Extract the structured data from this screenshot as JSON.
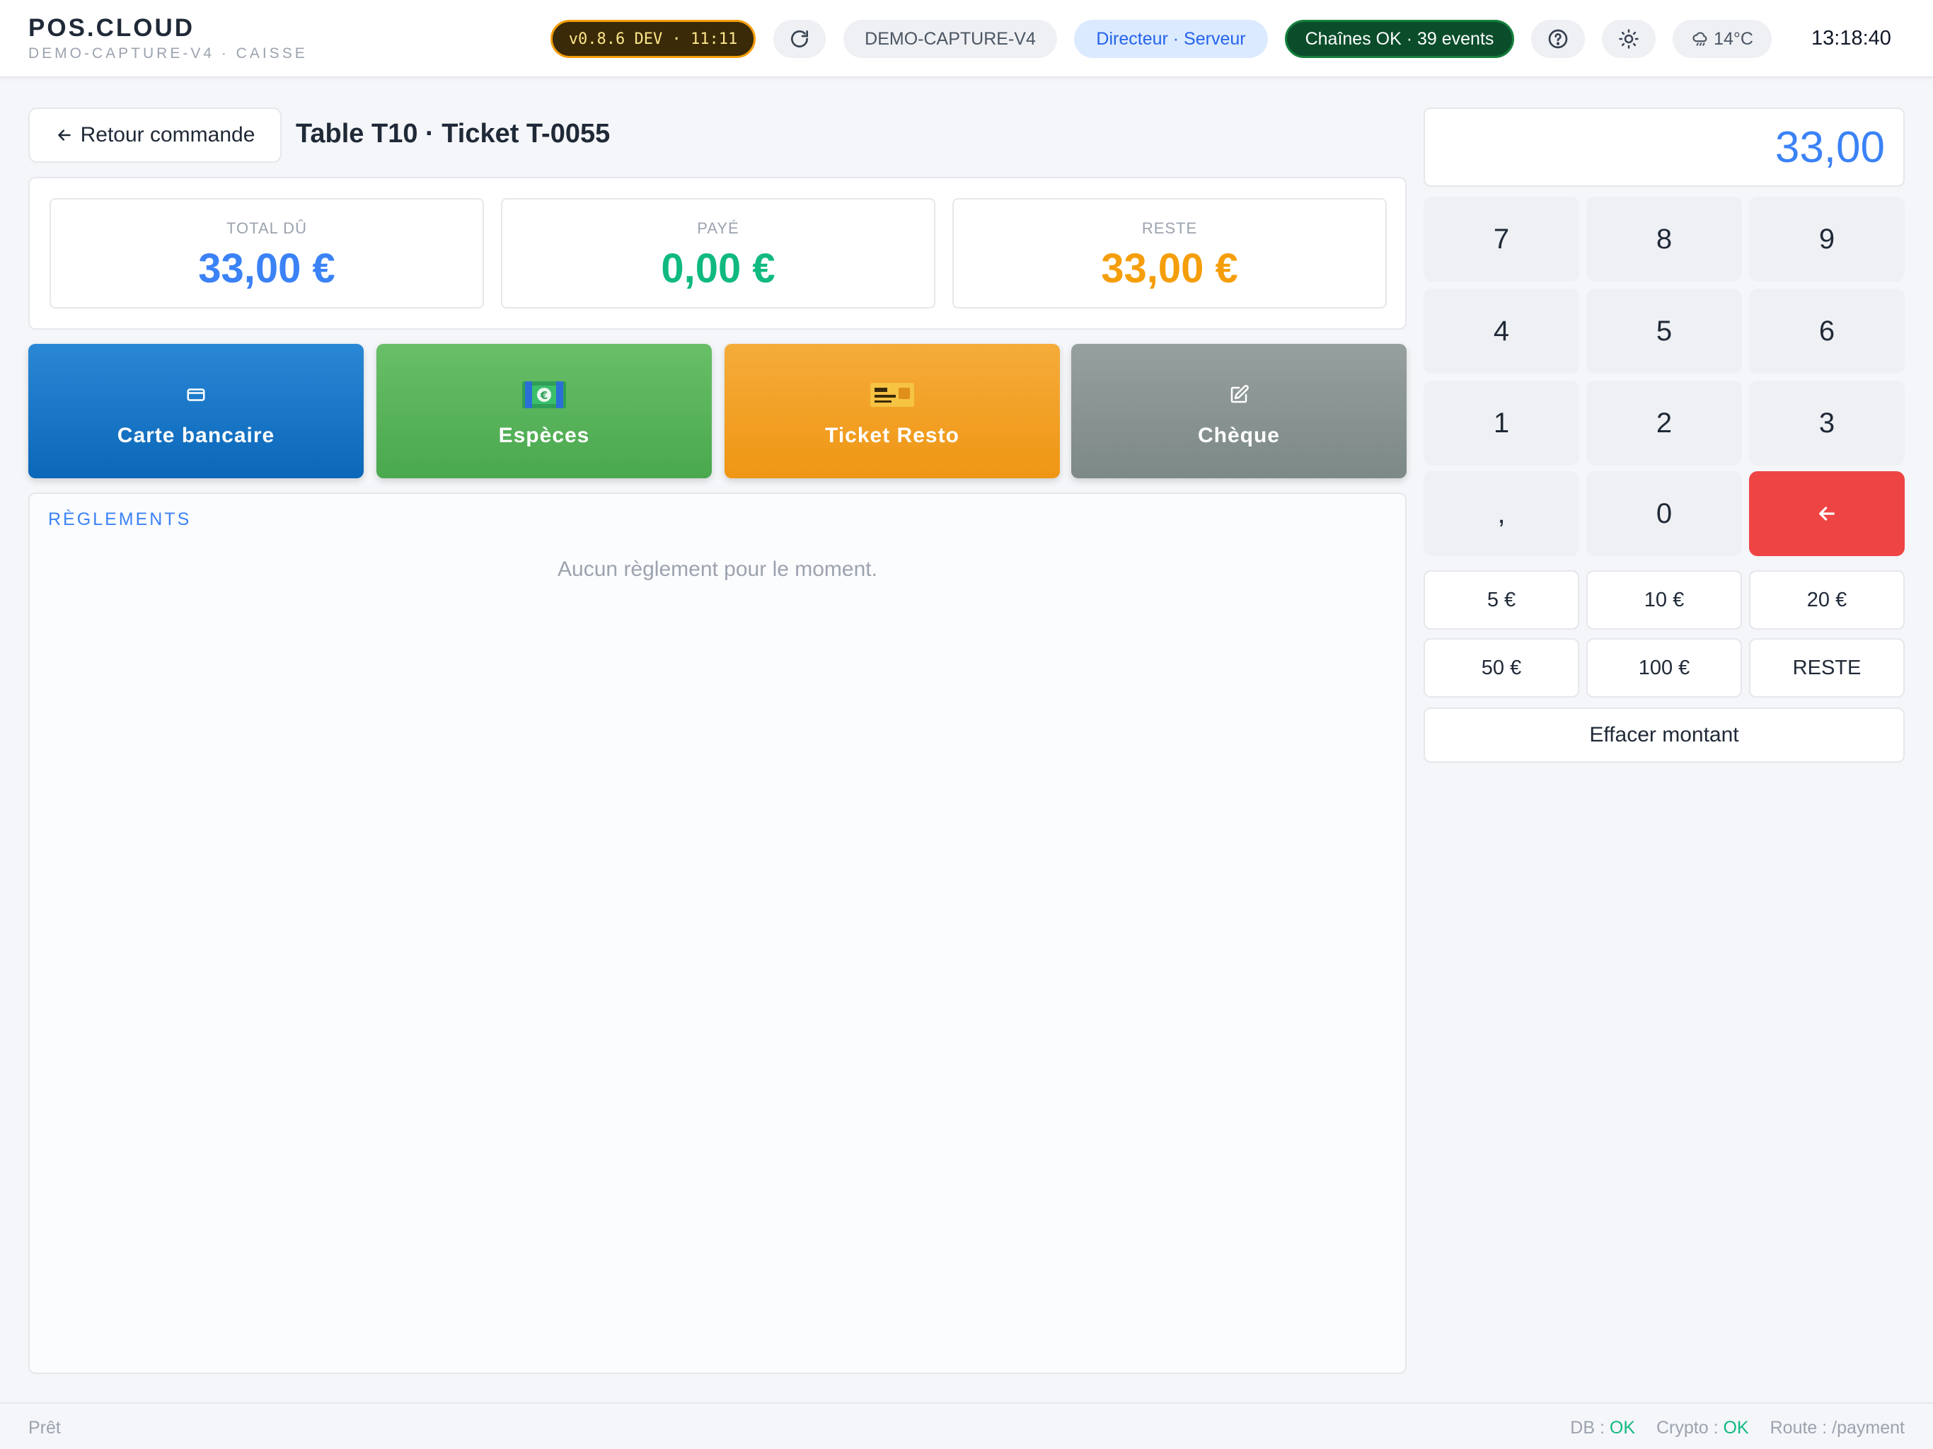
{
  "header": {
    "brand": "POS.CLOUD",
    "subtitle": "DEMO-CAPTURE-V4 · CAISSE",
    "version": "v0.8.6 DEV · 11:11",
    "device": "DEMO-CAPTURE-V4",
    "role": "Directeur · Serveur",
    "chains": "Chaînes OK · 39 events",
    "weather": "14°C",
    "time": "13:18:40",
    "icons": {
      "refresh": "refresh-icon",
      "help": "help-icon",
      "theme": "sun-icon",
      "weather": "cloud-rain-icon"
    }
  },
  "payment": {
    "back_label": "Retour commande",
    "title": "Table T10 · Ticket T-0055",
    "totals": {
      "due_label": "TOTAL DÛ",
      "due_value": "33,00 €",
      "paid_label": "PAYÉ",
      "paid_value": "0,00 €",
      "rest_label": "RESTE",
      "rest_value": "33,00 €"
    },
    "methods": [
      {
        "label": "Carte bancaire",
        "icon": "credit-card-icon",
        "color": "#1a76c9"
      },
      {
        "label": "Espèces",
        "icon": "banknote-icon",
        "color": "#56b15a"
      },
      {
        "label": "Ticket Resto",
        "icon": "ticket-icon",
        "color": "#f2a02a"
      },
      {
        "label": "Chèque",
        "icon": "edit-icon",
        "color": "#879391"
      }
    ],
    "reglements_title": "RÈGLEMENTS",
    "reglements_empty": "Aucun règlement pour le moment."
  },
  "keypad": {
    "display": "33,00",
    "keys": [
      "7",
      "8",
      "9",
      "4",
      "5",
      "6",
      "1",
      "2",
      "3",
      ",",
      "0"
    ],
    "backspace_icon": "arrow-left-icon",
    "quick": [
      "5 €",
      "10 €",
      "20 €",
      "50 €",
      "100 €",
      "RESTE"
    ],
    "clear": "Effacer montant"
  },
  "footer": {
    "status": "Prêt",
    "db_label": "DB :",
    "db_value": "OK",
    "crypto_label": "Crypto :",
    "crypto_value": "OK",
    "route": "Route : /payment"
  },
  "colors": {
    "accent": "#3b82f6",
    "paid": "#10b981",
    "rest": "#f59e0b",
    "danger": "#ef4444"
  }
}
